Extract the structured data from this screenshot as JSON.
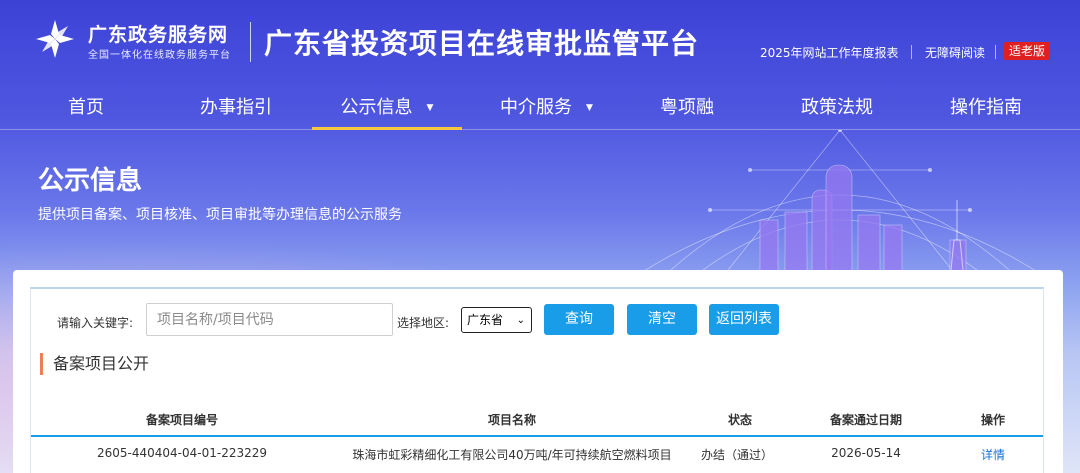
{
  "header": {
    "brand_name": "广东政务服务网",
    "brand_tagline": "全国一体化在线政务服务平台",
    "platform_title": "广东省投资项目在线审批监管平台",
    "report_link": "2025年网站工作年度报表",
    "accessibility_link": "无障碍阅读",
    "elder_mode": "适老版"
  },
  "nav": [
    {
      "label": "首页"
    },
    {
      "label": "办事指引"
    },
    {
      "label": "公示信息",
      "active": true
    },
    {
      "label": "中介服务"
    },
    {
      "label": "粤项融"
    },
    {
      "label": "政策法规"
    },
    {
      "label": "操作指南"
    }
  ],
  "hero": {
    "title": "公示信息",
    "subtitle": "提供项目备案、项目核准、项目审批等办理信息的公示服务"
  },
  "search": {
    "keyword_label": "请输入关键字:",
    "keyword_placeholder": "项目名称/项目代码",
    "keyword_value": "",
    "region_label": "选择地区:",
    "region_selected": "广东省",
    "query_button": "查询",
    "clear_button": "清空",
    "back_button": "返回列表"
  },
  "section": {
    "title": "备案项目公开"
  },
  "table": {
    "columns": [
      "备案项目编号",
      "项目名称",
      "状态",
      "备案通过日期",
      "操作"
    ],
    "rows": [
      {
        "code": "2605-440404-04-01-223229",
        "name": "珠海市虹彩精细化工有限公司40万吨/年可持续航空燃料项目",
        "status": "办结（通过）",
        "date": "2026-05-14",
        "action": "详情"
      }
    ]
  },
  "colors": {
    "accent": "#1a9de8",
    "nav_active_underline": "#f5c842",
    "section_marker": "#e8815a",
    "elder_badge": "#e02020",
    "link": "#1a73d9"
  },
  "icons": {
    "logo": "guangdong-gov-logo-icon",
    "region_dropdown": "chevron-down-icon",
    "nav_dropdown": "caret-down-icon"
  }
}
